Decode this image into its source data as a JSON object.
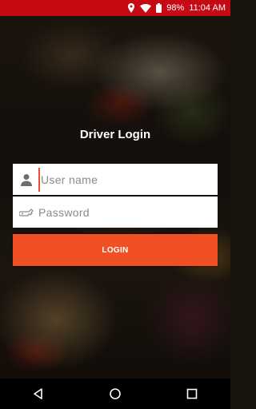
{
  "status_bar": {
    "battery": "98%",
    "time": "11:04 AM"
  },
  "title": "Driver Login",
  "username": {
    "placeholder": "User name",
    "value": ""
  },
  "password": {
    "placeholder": "Password",
    "value": ""
  },
  "login_button": "LOGIN",
  "colors": {
    "status_bar": "#c50a14",
    "accent": "#f05023"
  },
  "icons": {
    "location": "location-icon",
    "wifi": "wifi-icon",
    "battery": "battery-icon",
    "user": "user-icon",
    "password": "key-icon",
    "back": "back-icon",
    "home": "home-icon",
    "recents": "recents-icon"
  }
}
